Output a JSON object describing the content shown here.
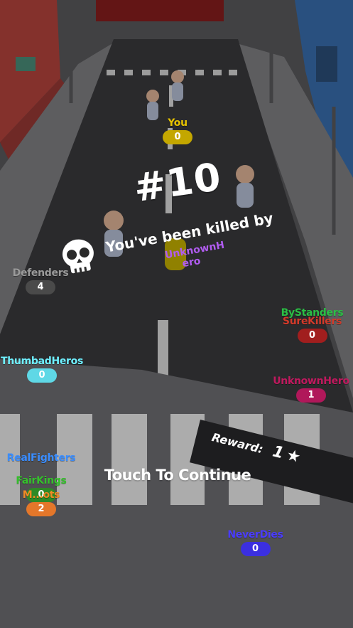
{
  "hud": {
    "rank": "#10",
    "killed_by_text": "You've been killed by",
    "killer_name": "UnknownH ero",
    "reward_label": "Reward:",
    "reward_value": "1",
    "continue_text": "Touch To Continue"
  },
  "players": [
    {
      "name": "You",
      "score": "0",
      "color": "#e6c200"
    },
    {
      "name": "Defenders",
      "score": "4",
      "color": "#9a9a9a"
    },
    {
      "name": "ByStanders",
      "score": "",
      "color": "#2bbf45"
    },
    {
      "name": "SureKillers",
      "score": "0",
      "color": "#d23a2a"
    },
    {
      "name": "ThumbadHeros",
      "score": "0",
      "color": "#6ff0ff"
    },
    {
      "name": "UnknownHero",
      "score": "1",
      "color": "#c0195e"
    },
    {
      "name": "RealFighters",
      "score": "",
      "color": "#3a8dff"
    },
    {
      "name": "FairKings",
      "score": "0",
      "color": "#35c02c"
    },
    {
      "name": "M...ots",
      "score": "2",
      "color": "#f08a24"
    },
    {
      "name": "NeverDies",
      "score": "0",
      "color": "#3b2fe0"
    }
  ],
  "colors": {
    "road": "#3a3a3c",
    "sidewalk": "#8a8a8e",
    "crosswalk": "#f2f2f2",
    "killer": "#b05cf0"
  },
  "icons": {
    "skull": "skull-icon",
    "star": "star-icon"
  }
}
